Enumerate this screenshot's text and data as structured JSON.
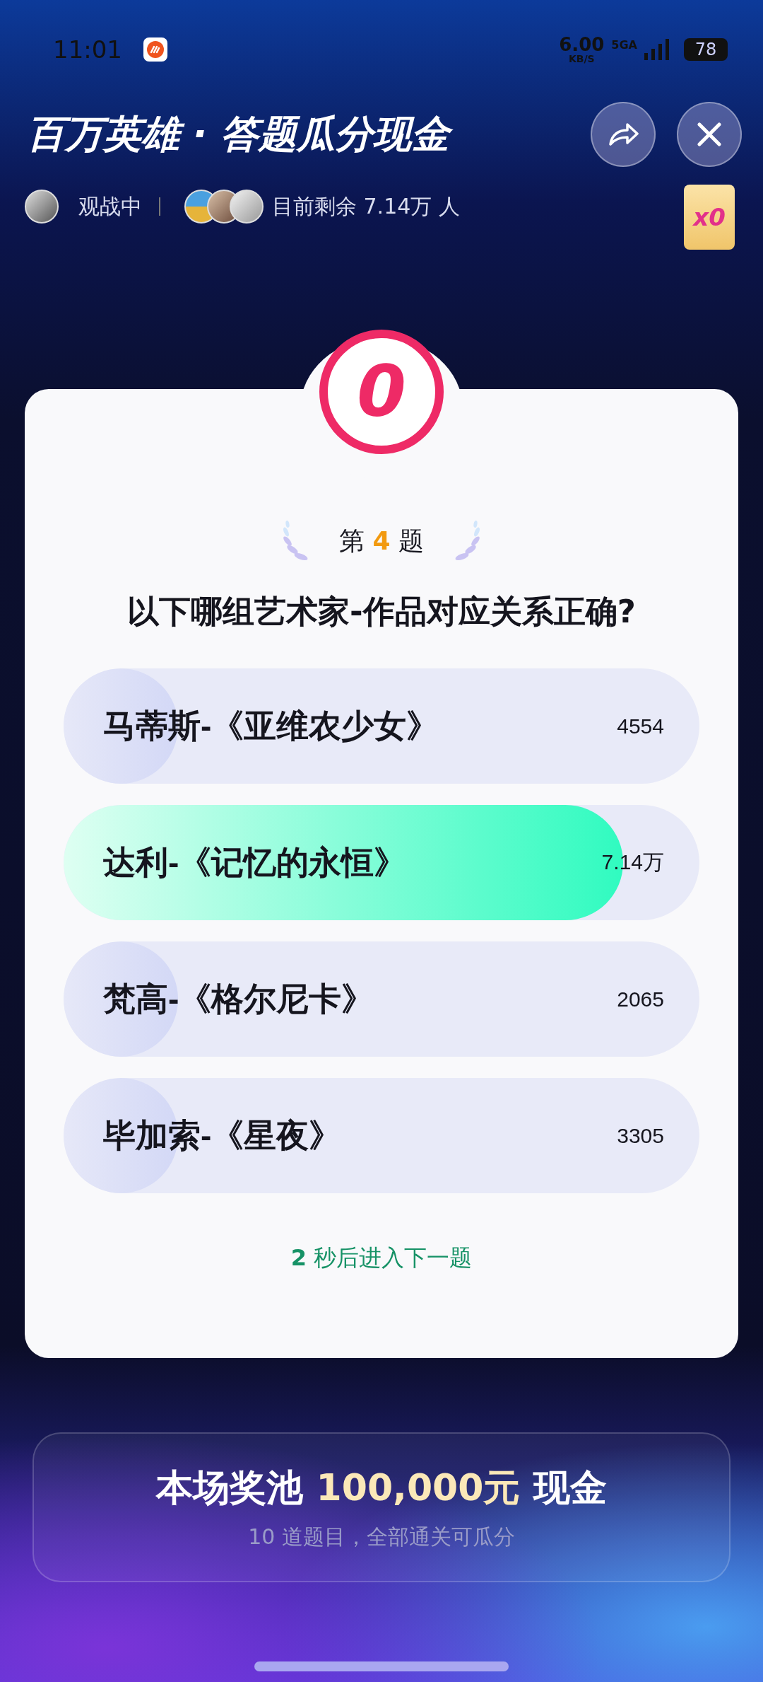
{
  "status_bar": {
    "time": "11:01",
    "net_speed": "6.00",
    "net_unit": "KB/S",
    "network": "5GA",
    "battery": "78"
  },
  "header": {
    "title": "百万英雄 · 答题瓜分现金",
    "spectating": "观战中",
    "remaining": "目前剩余 7.14万 人",
    "multiplier": "x0"
  },
  "score": "0",
  "question": {
    "prefix": "第",
    "number": "4",
    "suffix": "题",
    "text": "以下哪组艺术家-作品对应关系正确?"
  },
  "options": [
    {
      "label": "马蒂斯-《亚维农少女》",
      "count": "4554",
      "level": 0.18,
      "correct": false
    },
    {
      "label": "达利-《记忆的永恒》",
      "count": "7.14万",
      "level": 0.88,
      "correct": true
    },
    {
      "label": "梵高-《格尔尼卡》",
      "count": "2065",
      "level": 0.18,
      "correct": false
    },
    {
      "label": "毕加索-《星夜》",
      "count": "3305",
      "level": 0.18,
      "correct": false
    }
  ],
  "countdown": {
    "seconds": "2",
    "text": "秒后进入下一题"
  },
  "prize": {
    "prefix": "本场奖池",
    "amount": "100,000元",
    "suffix": "现金",
    "note": "10 道题目，全部通关可瓜分"
  }
}
